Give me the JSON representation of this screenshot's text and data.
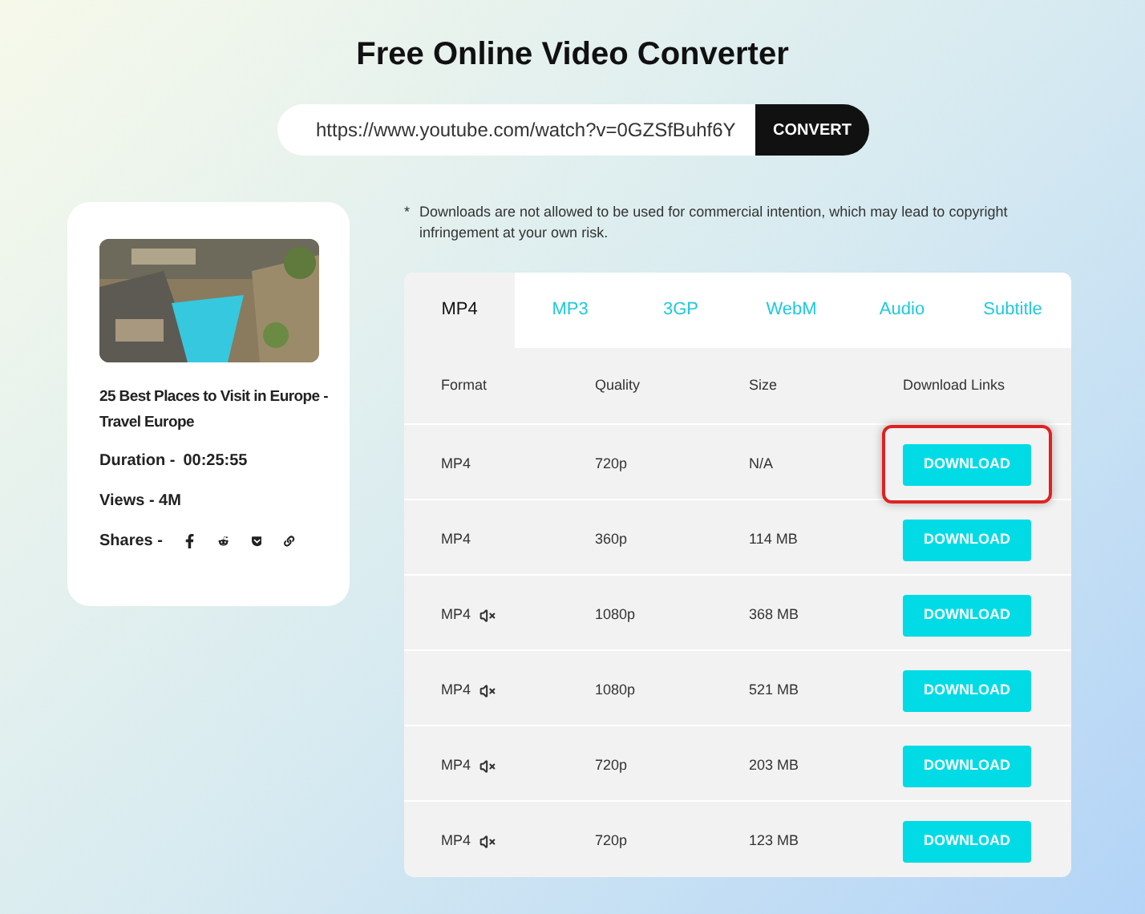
{
  "title": "Free Online Video Converter",
  "url_field": {
    "value": "https://www.youtube.com/watch?v=0GZSfBuhf6Y",
    "button": "CONVERT"
  },
  "video": {
    "title": "25 Best Places to Visit in Europe - Travel Europe",
    "duration_label": "Duration -",
    "duration": "00:25:55",
    "views": "Views - 4M",
    "shares_label": "Shares -",
    "shares": [
      {
        "kind": "facebook"
      },
      {
        "kind": "reddit"
      },
      {
        "kind": "pocket"
      },
      {
        "kind": "link"
      }
    ]
  },
  "note_mark": "*",
  "note": "Downloads are not allowed to be used for commercial intention, which may lead to copyright infringement at your own risk.",
  "tabs": [
    {
      "label": "MP4",
      "selected": true
    },
    {
      "label": "MP3",
      "selected": false
    },
    {
      "label": "3GP",
      "selected": false
    },
    {
      "label": "WebM",
      "selected": false
    },
    {
      "label": "Audio",
      "selected": false
    },
    {
      "label": "Subtitle",
      "selected": false
    }
  ],
  "table": {
    "columns": [
      "Format",
      "Quality",
      "Size",
      "Download Links"
    ],
    "rows": [
      {
        "format": "MP4",
        "muted": false,
        "quality": "720p",
        "size": "N/A",
        "button": "DOWNLOAD",
        "highlighted": true
      },
      {
        "format": "MP4",
        "muted": false,
        "quality": "360p",
        "size": "114 MB",
        "button": "DOWNLOAD",
        "highlighted": false
      },
      {
        "format": "MP4",
        "muted": true,
        "quality": "1080p",
        "size": "368 MB",
        "button": "DOWNLOAD",
        "highlighted": false
      },
      {
        "format": "MP4",
        "muted": true,
        "quality": "1080p",
        "size": "521 MB",
        "button": "DOWNLOAD",
        "highlighted": false
      },
      {
        "format": "MP4",
        "muted": true,
        "quality": "720p",
        "size": "203 MB",
        "button": "DOWNLOAD",
        "highlighted": false
      },
      {
        "format": "MP4",
        "muted": true,
        "quality": "720p",
        "size": "123 MB",
        "button": "DOWNLOAD",
        "highlighted": false
      }
    ]
  }
}
